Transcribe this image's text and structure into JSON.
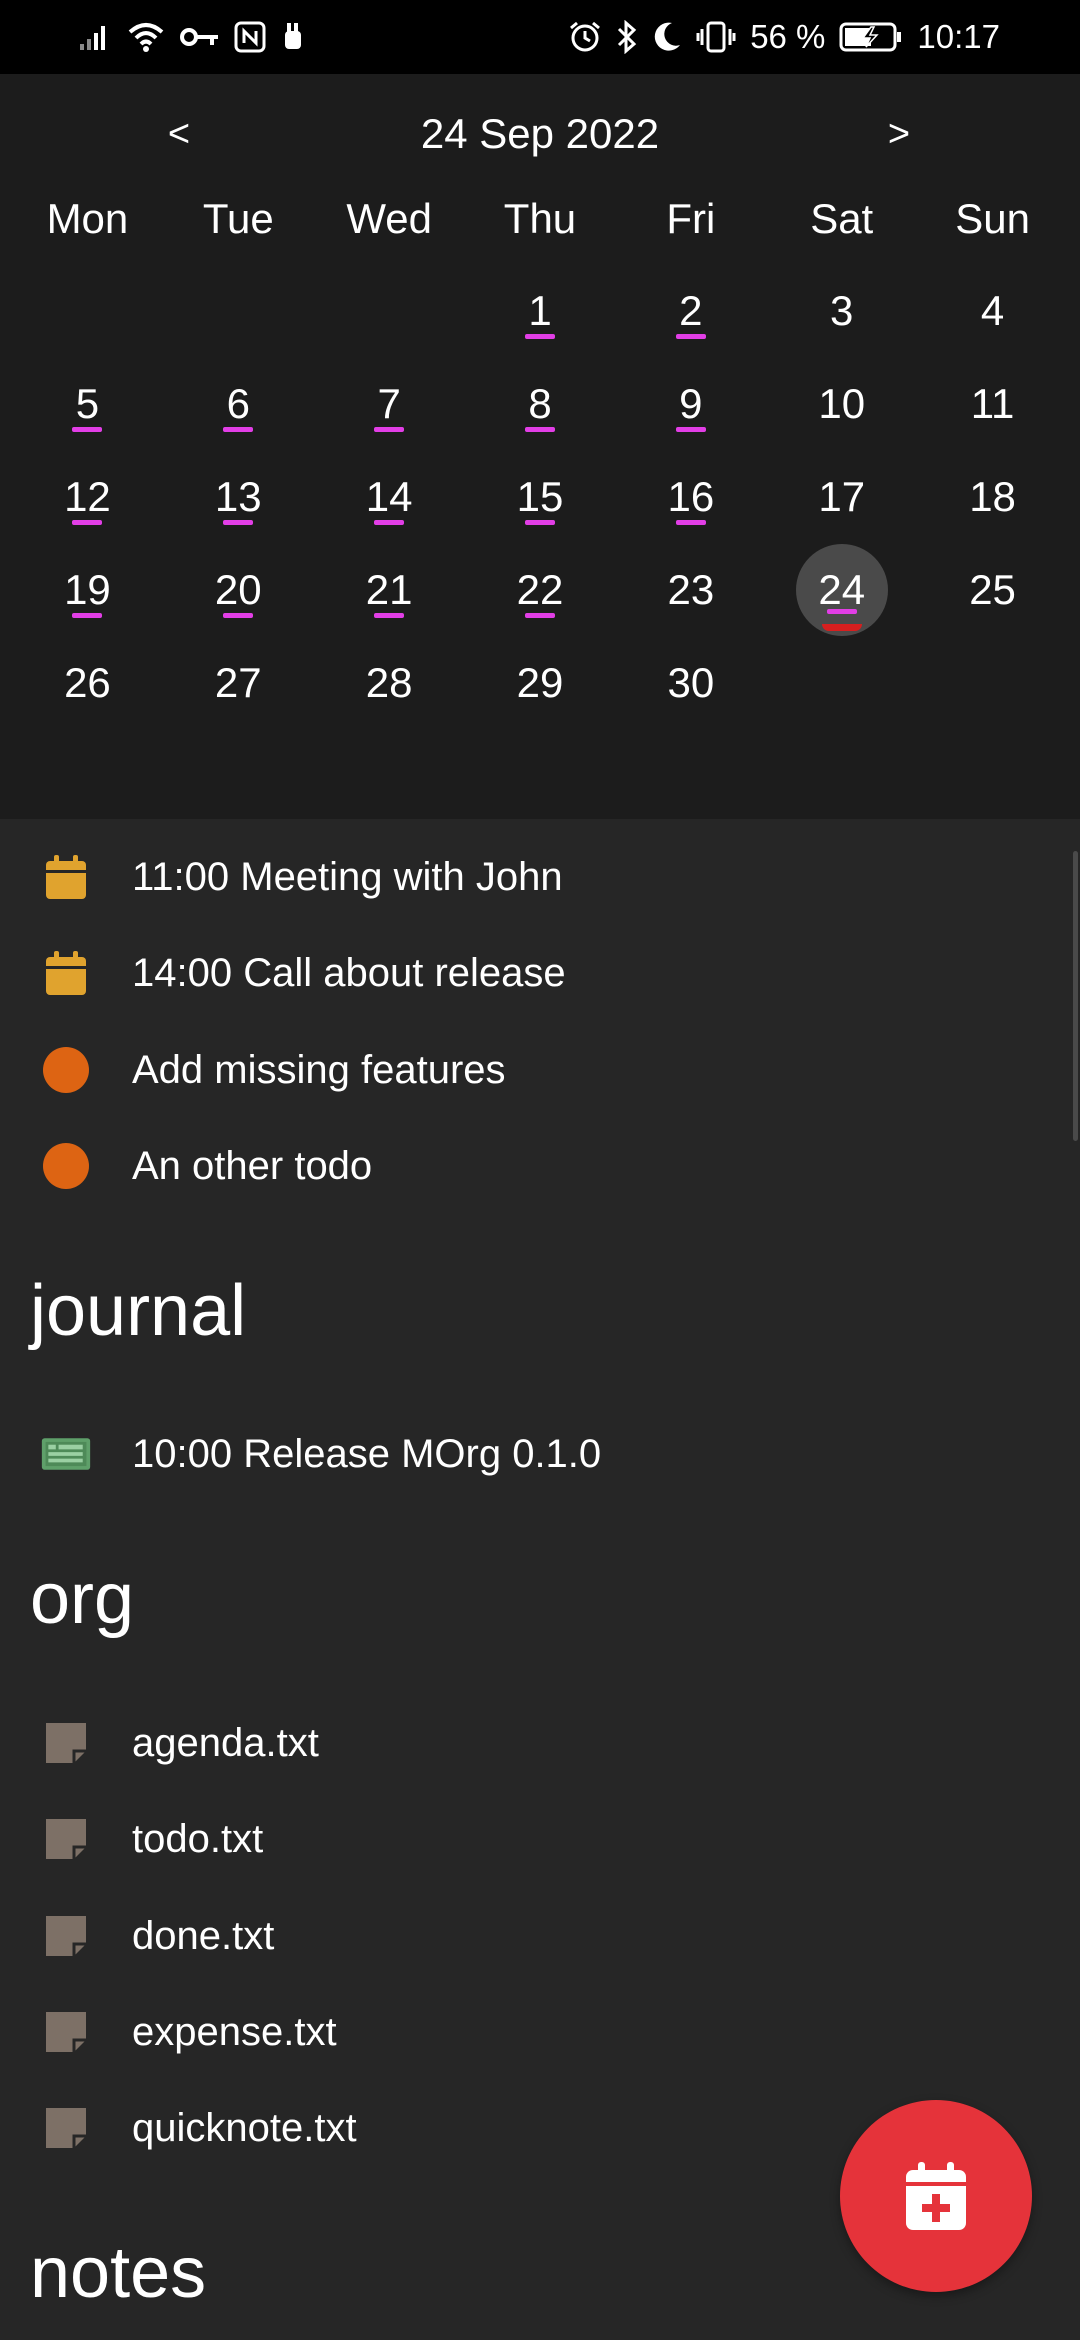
{
  "status_bar": {
    "battery": "56 %",
    "time": "10:17"
  },
  "calendar": {
    "title": "24 Sep 2022",
    "prev_label": "<",
    "next_label": ">",
    "weekdays": [
      "Mon",
      "Tue",
      "Wed",
      "Thu",
      "Fri",
      "Sat",
      "Sun"
    ],
    "selected_day": "24",
    "days": [
      {
        "label": "",
        "marked": false
      },
      {
        "label": "",
        "marked": false
      },
      {
        "label": "",
        "marked": false
      },
      {
        "label": "1",
        "marked": true
      },
      {
        "label": "2",
        "marked": true
      },
      {
        "label": "3",
        "marked": false
      },
      {
        "label": "4",
        "marked": false
      },
      {
        "label": "5",
        "marked": true
      },
      {
        "label": "6",
        "marked": true
      },
      {
        "label": "7",
        "marked": true
      },
      {
        "label": "8",
        "marked": true
      },
      {
        "label": "9",
        "marked": true
      },
      {
        "label": "10",
        "marked": false
      },
      {
        "label": "11",
        "marked": false
      },
      {
        "label": "12",
        "marked": true
      },
      {
        "label": "13",
        "marked": true
      },
      {
        "label": "14",
        "marked": true
      },
      {
        "label": "15",
        "marked": true
      },
      {
        "label": "16",
        "marked": true
      },
      {
        "label": "17",
        "marked": false
      },
      {
        "label": "18",
        "marked": false
      },
      {
        "label": "19",
        "marked": true
      },
      {
        "label": "20",
        "marked": true
      },
      {
        "label": "21",
        "marked": true
      },
      {
        "label": "22",
        "marked": true
      },
      {
        "label": "23",
        "marked": false
      },
      {
        "label": "24",
        "marked": true
      },
      {
        "label": "25",
        "marked": false
      },
      {
        "label": "26",
        "marked": false
      },
      {
        "label": "27",
        "marked": false
      },
      {
        "label": "28",
        "marked": false
      },
      {
        "label": "29",
        "marked": false
      },
      {
        "label": "30",
        "marked": false
      }
    ]
  },
  "agenda": {
    "items": [
      {
        "label": "11:00 Meeting with John",
        "icon": "calendar-icon"
      },
      {
        "label": "14:00 Call about release",
        "icon": "calendar-icon"
      },
      {
        "label": "Add missing features",
        "icon": "todo-dot-icon"
      },
      {
        "label": "An other todo",
        "icon": "todo-dot-icon"
      }
    ]
  },
  "journal": {
    "title": "journal",
    "items": [
      {
        "label": "10:00 Release MOrg 0.1.0",
        "icon": "journal-entry-icon"
      }
    ]
  },
  "org": {
    "title": "org",
    "files": [
      {
        "label": "agenda.txt",
        "icon": "note-file-icon"
      },
      {
        "label": "todo.txt",
        "icon": "note-file-icon"
      },
      {
        "label": "done.txt",
        "icon": "note-file-icon"
      },
      {
        "label": "expense.txt",
        "icon": "note-file-icon"
      },
      {
        "label": "quicknote.txt",
        "icon": "note-file-icon"
      }
    ]
  },
  "notes": {
    "title": "notes"
  },
  "fab": {
    "icon": "add-event-icon"
  },
  "colors": {
    "calendar_bg": "#1c1c1c",
    "content_bg": "#262626",
    "day_marker": "#e23ee6",
    "event_icon": "#e0a32e",
    "todo_icon": "#dd6413",
    "journal_icon": "#5fa06a",
    "file_icon": "#7d7066",
    "fab": "#e5333a"
  }
}
